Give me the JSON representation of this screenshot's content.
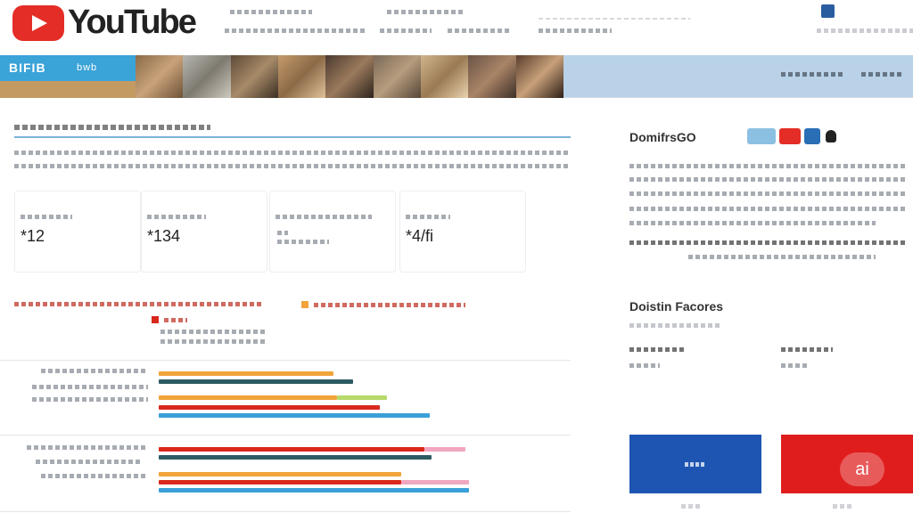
{
  "header": {
    "logo_text": "YouTube",
    "logo_icon": "play-button-icon"
  },
  "banner": {
    "title": "BIFIB",
    "subtitle": "bwb",
    "accent": "#b9d2e8"
  },
  "main": {
    "stats": [
      {
        "value": "*12"
      },
      {
        "value": "*134"
      },
      {
        "value": ""
      },
      {
        "value": "*4/fi"
      }
    ],
    "chart_legend": {
      "series_a_color": "#f2a33a",
      "series_b_color": "#d9281c"
    }
  },
  "sidebar": {
    "title": "DomifrsGO",
    "section_title": "Doistin Facores",
    "icons": [
      "tablet-icon",
      "youtube-icon",
      "telegram-icon",
      "person-icon"
    ],
    "buttons": [
      {
        "label": ""
      },
      {
        "label": ""
      }
    ],
    "ai_badge": "ai"
  },
  "colors": {
    "brand_red": "#e52d27",
    "blue": "#1f55b2",
    "red": "#e01d1d",
    "bar_orange": "#f2a33a",
    "bar_teal": "#2e5b63",
    "bar_red": "#d9281c",
    "bar_blue": "#3aa0d8",
    "bar_pink": "#f1a7c1"
  }
}
